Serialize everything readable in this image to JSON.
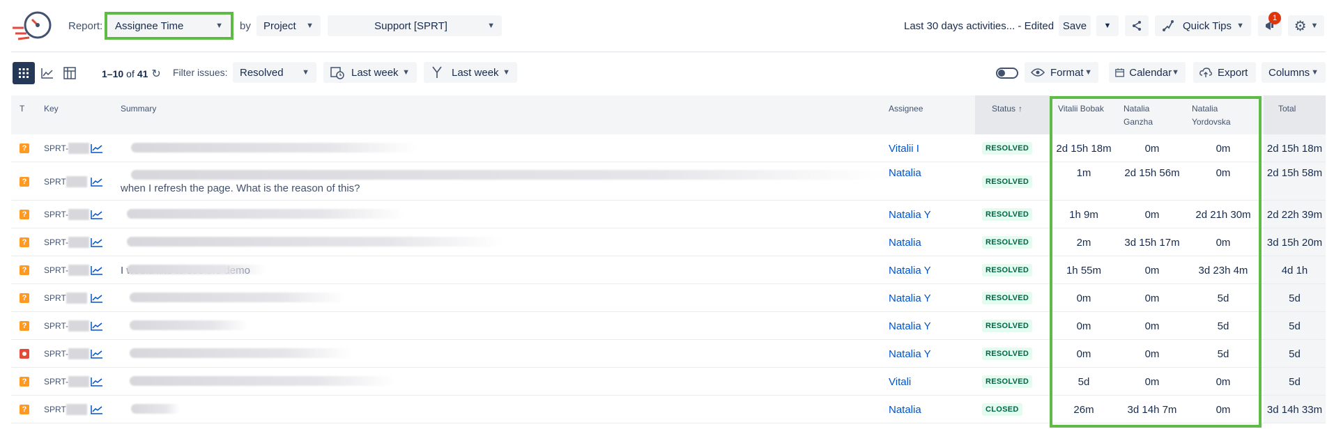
{
  "toolbar": {
    "report_label": "Report:",
    "report_value": "Assignee Time",
    "by_label": "by",
    "by_value": "Project",
    "project_value": "Support [SPRT]",
    "saved_view": "Last 30 days activities... - Edited",
    "save_label": "Save",
    "quick_tips_label": "Quick Tips",
    "notification_count": "1"
  },
  "filterbar": {
    "paging_prefix": "1–10",
    "paging_of": "of",
    "paging_total": "41",
    "filter_label": "Filter issues:",
    "filter_value": "Resolved",
    "date_range_1": "Last week",
    "date_range_2": "Last week",
    "format_label": "Format",
    "calendar_label": "Calendar",
    "export_label": "Export",
    "columns_label": "Columns"
  },
  "table": {
    "headers": {
      "type": "T",
      "key": "Key",
      "summary": "Summary",
      "assignee": "Assignee",
      "status": "Status",
      "user1": "Vitalii Bobak",
      "user2_line1": "Natalia",
      "user2_line2": "Ganzha",
      "user3_line1": "Natalia",
      "user3_line2": "Yordovska",
      "total": "Total"
    },
    "rows": [
      {
        "type": "question",
        "key": "SPRT-",
        "summary": "",
        "assignee": "Vitalii I",
        "status": "RESOLVED",
        "u1": "2d 15h 18m",
        "u2": "0m",
        "u3": "0m",
        "total": "2d 15h 18m"
      },
      {
        "type": "question",
        "key": "SPRT",
        "summary": "when I refresh the page. What is the reason of this?",
        "assignee": "Natalia",
        "status": "RESOLVED",
        "u1": "1m",
        "u2": "2d 15h 56m",
        "u3": "0m",
        "total": "2d 15h 58m"
      },
      {
        "type": "question",
        "key": "SPRT-",
        "summary": "",
        "assignee": "Natalia Y",
        "status": "RESOLVED",
        "u1": "1h 9m",
        "u2": "0m",
        "u3": "2d 21h 30m",
        "total": "2d 22h 39m"
      },
      {
        "type": "question",
        "key": "SPRT-",
        "summary": "",
        "assignee": "Natalia",
        "status": "RESOLVED",
        "u1": "2m",
        "u2": "3d 15h 17m",
        "u3": "0m",
        "total": "3d 15h 20m"
      },
      {
        "type": "question",
        "key": "SPRT-",
        "summary": "I would like to see the demo",
        "assignee": "Natalia Y",
        "status": "RESOLVED",
        "u1": "1h 55m",
        "u2": "0m",
        "u3": "3d 23h 4m",
        "total": "4d 1h"
      },
      {
        "type": "question",
        "key": "SPRT",
        "summary": "",
        "assignee": "Natalia Y",
        "status": "RESOLVED",
        "u1": "0m",
        "u2": "0m",
        "u3": "5d",
        "total": "5d"
      },
      {
        "type": "question",
        "key": "SPRT-",
        "summary": "",
        "assignee": "Natalia Y",
        "status": "RESOLVED",
        "u1": "0m",
        "u2": "0m",
        "u3": "5d",
        "total": "5d"
      },
      {
        "type": "bug",
        "key": "SPRT-",
        "summary": "",
        "assignee": "Natalia Y",
        "status": "RESOLVED",
        "u1": "0m",
        "u2": "0m",
        "u3": "5d",
        "total": "5d"
      },
      {
        "type": "question",
        "key": "SPRT-",
        "summary": "",
        "assignee": "Vitali",
        "status": "RESOLVED",
        "u1": "5d",
        "u2": "0m",
        "u3": "0m",
        "total": "5d"
      },
      {
        "type": "question",
        "key": "SPRT",
        "summary": "",
        "assignee": "Natalia",
        "status": "CLOSED",
        "u1": "26m",
        "u2": "3d 14h 7m",
        "u3": "0m",
        "total": "3d 14h 33m"
      }
    ]
  },
  "colors": {
    "highlight": "#5dbb46",
    "link": "#0052cc",
    "badge_text": "#006644",
    "badge_bg": "#e3fcef",
    "question_icon": "#ff991f",
    "bug_icon": "#e5493a",
    "notification": "#de350b"
  },
  "icons": [
    "timer-logo-icon",
    "share-icon",
    "quick-tips-icon",
    "megaphone-icon",
    "gear-icon",
    "grid-view-icon",
    "chart-view-icon",
    "pivot-view-icon",
    "refresh-icon",
    "calendar-clock-icon",
    "branch-icon",
    "toggle-icon",
    "eye-icon",
    "calendar-icon",
    "export-icon",
    "trend-chart-icon",
    "question-type-icon",
    "bug-type-icon",
    "sort-up-icon"
  ]
}
